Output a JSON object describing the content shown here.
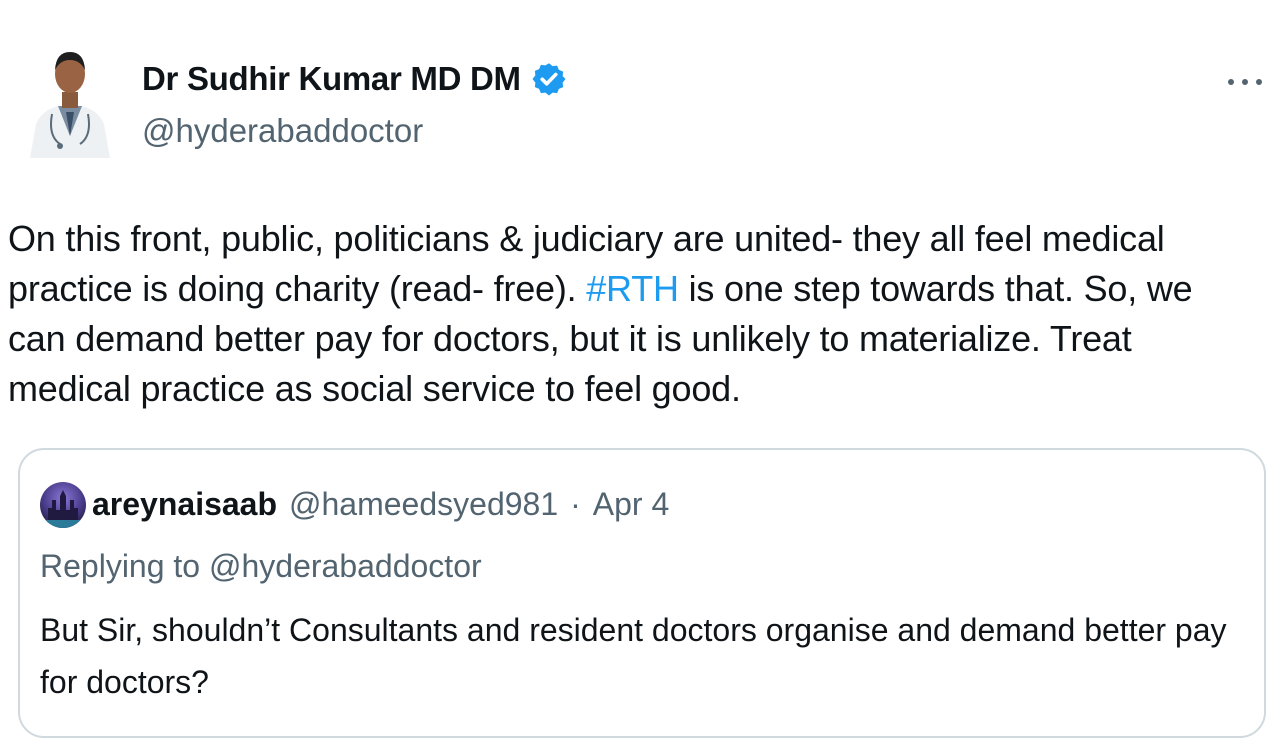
{
  "author": {
    "display_name": "Dr Sudhir Kumar MD DM",
    "handle": "@hyderabaddoctor",
    "verified_icon": "verified-badge-icon"
  },
  "tweet": {
    "text_before": "On this front, public, politicians & judiciary are united- they all feel medical practice is doing charity (read- free). ",
    "hashtag": "#RTH",
    "text_after": " is one step towards that. So, we can demand better pay for doctors, but it is unlikely to materialize. Treat medical practice as social service to feel good."
  },
  "quote": {
    "name": "areynaisaab",
    "handle": "@hameedsyed981",
    "separator": "·",
    "date": "Apr 4",
    "replying_label": "Replying to",
    "replying_handle": "@hyderabaddoctor",
    "text": "But Sir, shouldn’t Consultants and resident doctors organise and demand better pay for doctors?"
  },
  "colors": {
    "text_primary": "#0f1419",
    "text_secondary": "#536471",
    "accent": "#1d9bf0",
    "border": "#cfd9de"
  }
}
